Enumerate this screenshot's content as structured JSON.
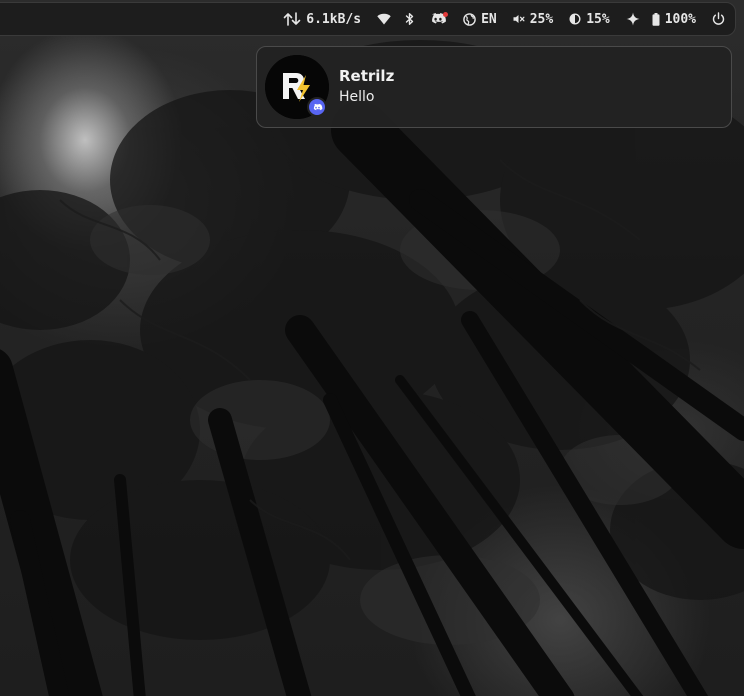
{
  "topbar": {
    "network_speed": "6.1kB/s",
    "language": "EN",
    "volume": "25%",
    "brightness": "15%",
    "battery": "100%",
    "icons": {
      "network_speed": "up-down-arrows-icon",
      "wifi": "wifi-icon",
      "bluetooth": "bluetooth-icon",
      "discord": "discord-icon",
      "language": "globe-icon",
      "volume": "speaker-muted-icon",
      "brightness": "brightness-icon",
      "sparkle": "sparkle-icon",
      "battery": "battery-icon",
      "power": "power-icon"
    }
  },
  "notification": {
    "app": "discord",
    "app_color": "#5865f2",
    "title": "Retrilz",
    "body": "Hello"
  },
  "wallpaper": {
    "subject": "dark forest"
  }
}
